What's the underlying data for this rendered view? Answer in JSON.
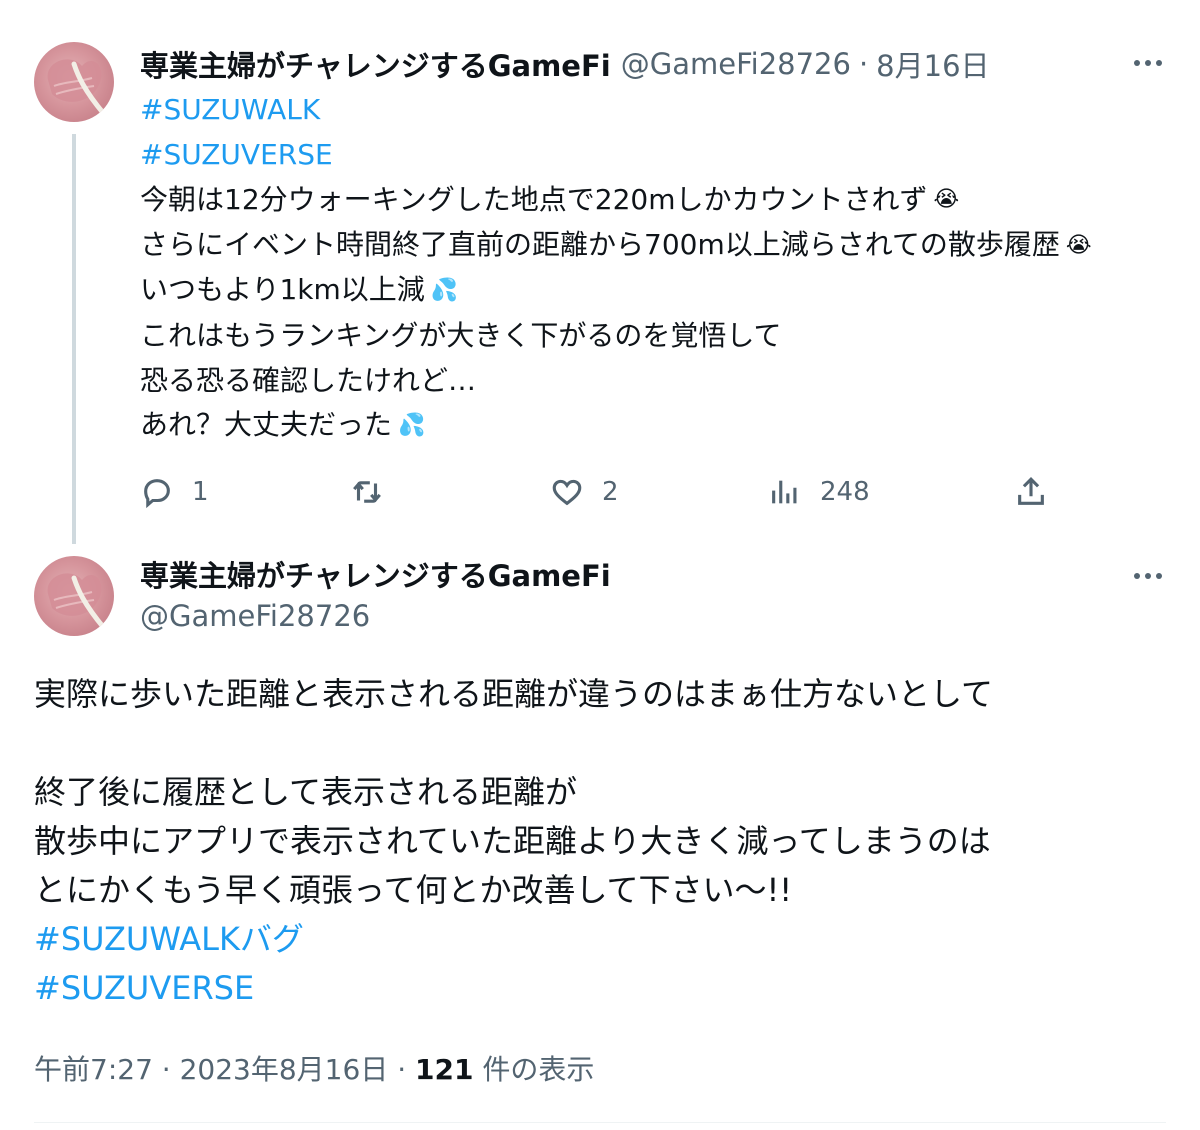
{
  "parent_tweet": {
    "display_name": "専業主婦がチャレンジするGameFi",
    "handle": "@GameFi28726",
    "separator": "·",
    "date": "8月16日",
    "lines": [
      "#SUZUWALK",
      "#SUZUVERSE",
      "今朝は12分ウォーキングした地点で220mしかカウントされず",
      "さらにイベント時間終了直前の距離から700m以上減らされての散歩履歴",
      "いつもより1km以上減",
      "これはもうランキングが大きく下がるのを覚悟して",
      "恐る恐る確認したけれど…",
      "あれ？大丈夫だった"
    ],
    "emojis": {
      "crying_face": "😭",
      "sweat_droplets": "💦"
    },
    "actions": {
      "reply_count": "1",
      "retweet_count": "",
      "like_count": "2",
      "views_count": "248"
    },
    "icons": {
      "reply": "reply-icon",
      "retweet": "retweet-icon",
      "like": "heart-icon",
      "views": "views-chart-icon",
      "share": "share-icon",
      "more": "more-icon"
    }
  },
  "focused_tweet": {
    "display_name": "専業主婦がチャレンジするGameFi",
    "handle": "@GameFi28726",
    "lines": [
      "実際に歩いた距離と表示される距離が違うのはまぁ仕方ないとして",
      "",
      "終了後に履歴として表示される距離が",
      "散歩中にアプリで表示されていた距離より大きく減ってしまうのは",
      "とにかくもう早く頑張って何とか改善して下さい〜!!",
      "#SUZUWALKバグ",
      "#SUZUVERSE"
    ],
    "meta": {
      "time": "午前7:27",
      "separator": "·",
      "date": "2023年8月16日",
      "separator2": "·",
      "views_count": "121",
      "views_label": "件の表示"
    }
  },
  "colors": {
    "text": "#0f1419",
    "secondary": "#536471",
    "link": "#1d9bf0",
    "thread_line": "#cfd9de"
  }
}
